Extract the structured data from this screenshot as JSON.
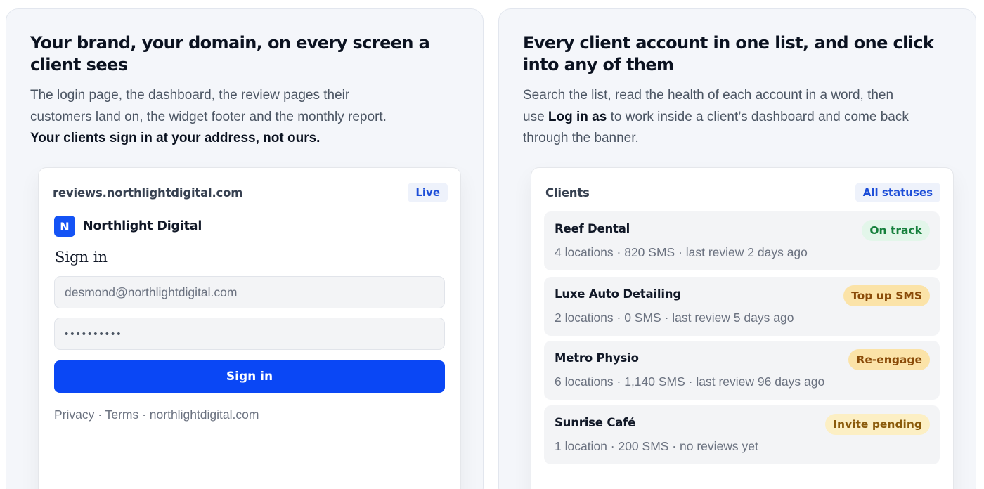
{
  "left_card": {
    "heading": "Your brand, your domain, on every screen a client sees",
    "lead_text": "The login page, the dashboard, the review pages their customers land on, the widget footer and the monthly report. ",
    "lead_strong": "Your clients sign in at your address, not ours.",
    "panel": {
      "domain": "reviews.northlightdigital.com",
      "status_chip": "Live",
      "logo_letter": "N",
      "brand_name": "Northlight Digital",
      "signin_title": "Sign in",
      "email_value": "desmond@northlightdigital.com",
      "password_mask": "••••••••••",
      "signin_button": "Sign in",
      "footer_links": "Privacy · Terms · northlightdigital.com"
    }
  },
  "right_card": {
    "heading": "Every client account in one list, and one click into any of them",
    "lead_part1": "Search the list, read the health of each account in a word, then use ",
    "lead_strong": "Log in as",
    "lead_part2": " to work inside a client’s dashboard and come back through the banner.",
    "panel": {
      "title": "Clients",
      "filter_chip": "All statuses",
      "clients": [
        {
          "name": "Reef Dental",
          "meta": "4 locations · 820 SMS · last review 2 days ago",
          "status": "On track",
          "status_color": "#16803c"
        },
        {
          "name": "Luxe Auto Detailing",
          "meta": "2 locations · 0 SMS · last review 5 days ago",
          "status": "Top up SMS",
          "status_color": "#8a4b08"
        },
        {
          "name": "Metro Physio",
          "meta": "6 locations · 1,140 SMS · last review 96 days ago",
          "status": "Re-engage",
          "status_color": "#8a4b08"
        },
        {
          "name": "Sunrise Café",
          "meta": "1 location · 200 SMS · no reviews yet",
          "status": "Invite pending",
          "status_color": "#8a5a0a"
        }
      ]
    }
  },
  "colors": {
    "accent_blue": "#0a47f5",
    "card_bg": "#f4f6fa"
  }
}
